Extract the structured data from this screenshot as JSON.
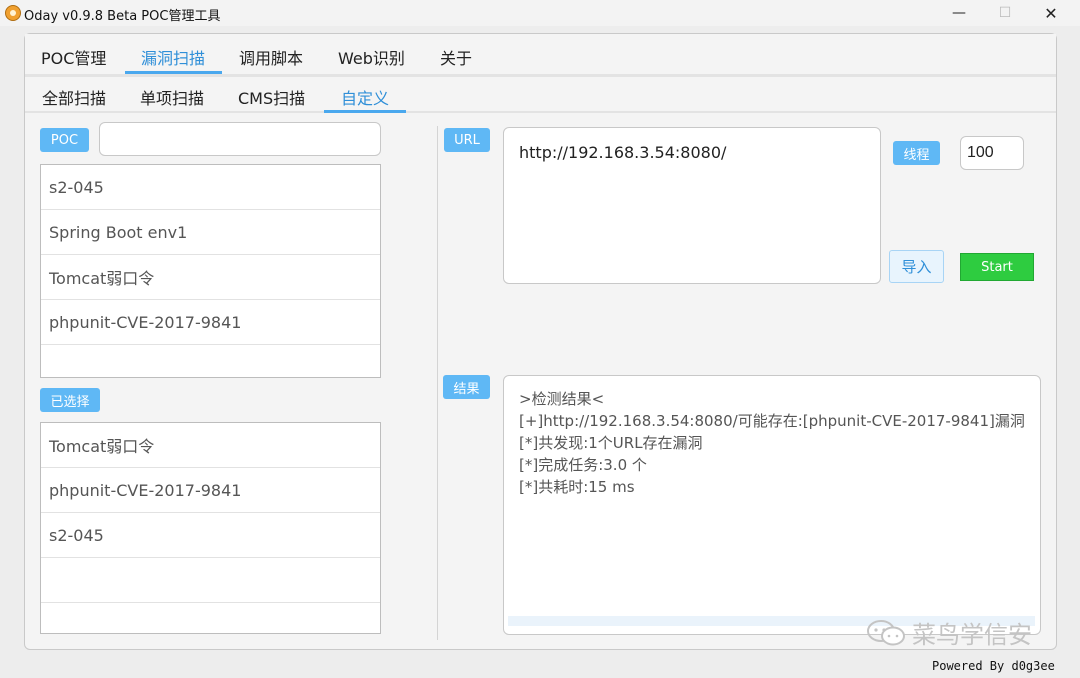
{
  "window": {
    "title": "Oday v0.9.8 Beta POC管理工具",
    "minimize_glyph": "—",
    "maximize_glyph": "☐",
    "close_glyph": "✕"
  },
  "tabs": [
    "POC管理",
    "漏洞扫描",
    "调用脚本",
    "Web识别",
    "关于"
  ],
  "active_tab": "漏洞扫描",
  "subtabs": [
    "全部扫描",
    "单项扫描",
    "CMS扫描",
    "自定义"
  ],
  "active_subtab": "自定义",
  "left": {
    "poc_label": "POC",
    "poc_search_value": "",
    "poc_list": [
      "s2-045",
      "Spring Boot env1",
      "Tomcat弱口令",
      "phpunit-CVE-2017-9841"
    ],
    "selected_label": "已选择",
    "selected_list": [
      "Tomcat弱口令",
      "phpunit-CVE-2017-9841",
      "s2-045"
    ]
  },
  "right": {
    "url_label": "URL",
    "url_value": "http://192.168.3.54:8080/",
    "threads_label": "线程",
    "threads_value": "100",
    "import_label": "导入",
    "start_label": "Start",
    "result_label": "结果",
    "result_lines": [
      ">检测结果<",
      "[+]http://192.168.3.54:8080/可能存在:[phpunit-CVE-2017-9841]漏洞",
      "[*]共发现:1个URL存在漏洞",
      "[*]完成任务:3.0 个",
      "[*]共耗时:15 ms"
    ]
  },
  "watermark": "菜鸟学信安",
  "footer": "Powered By d0g3ee",
  "colors": {
    "accent": "#4aa8ee",
    "badge": "#5fb8f5",
    "start_button": "#2ecc40"
  }
}
